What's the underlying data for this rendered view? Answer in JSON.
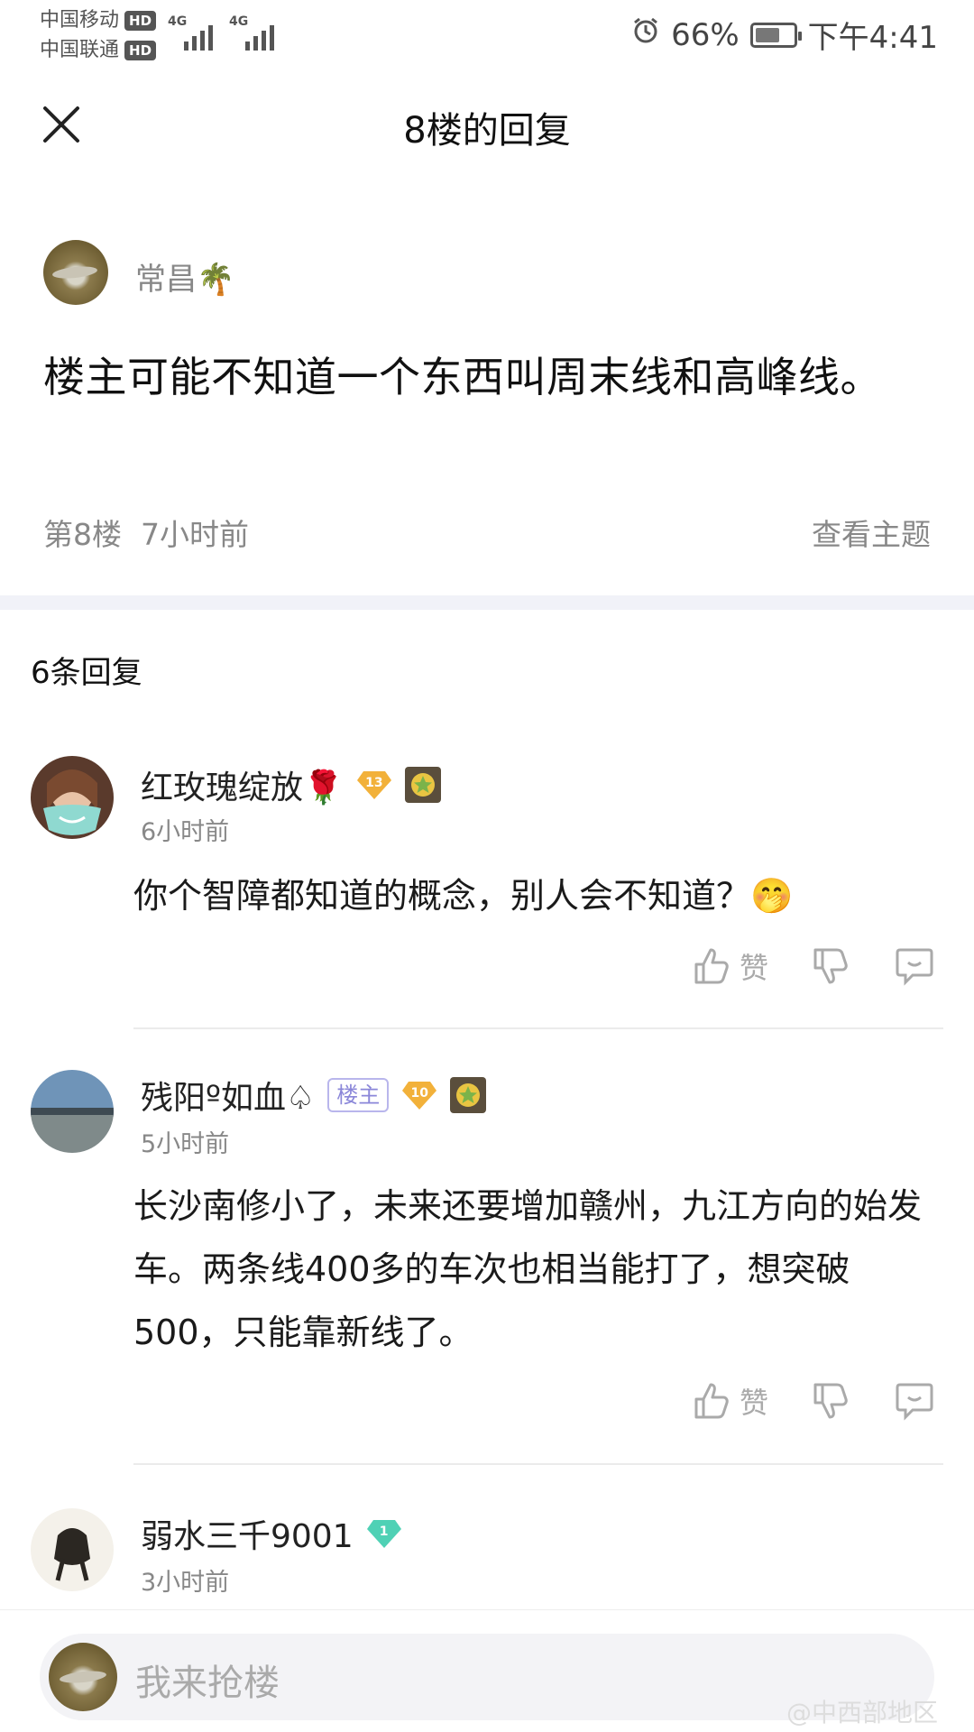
{
  "status_bar": {
    "carrier1": "中国移动",
    "carrier2": "中国联通",
    "hd": "HD",
    "net1": "4G",
    "net2": "4G",
    "battery": "66%",
    "battery_level": 0.66,
    "time": "下午4:41"
  },
  "header": {
    "title": "8楼的回复"
  },
  "post": {
    "author": "常昌🌴",
    "body": "楼主可能不知道一个东西叫周末线和高峰线。",
    "floor": "第8楼",
    "time": "7小时前",
    "view_topic": "查看主题"
  },
  "reply_count": "6条回复",
  "replies": [
    {
      "author": "红玫瑰绽放🌹",
      "level": "13",
      "time": "6小时前",
      "body": "你个智障都知道的概念，别人会不知道？🤭",
      "like_label": "赞"
    },
    {
      "author": "残阳º如血♤",
      "owner_tag": "楼主",
      "level": "10",
      "time": "5小时前",
      "body": "长沙南修小了，未来还要增加赣州，九江方向的始发车。两条线400多的车次也相当能打了，想突破500，只能靠新线了。",
      "like_label": "赞"
    },
    {
      "author": "弱水三千9001",
      "level": "1",
      "time": "3小时前"
    }
  ],
  "composer": {
    "placeholder": "我来抢楼",
    "watermark": "@中西部地区"
  }
}
